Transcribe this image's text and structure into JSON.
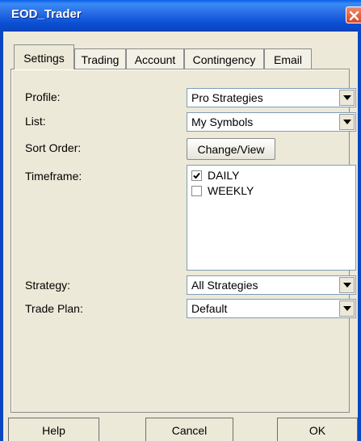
{
  "window": {
    "title": "EOD_Trader"
  },
  "tabs": [
    {
      "label": "Settings"
    },
    {
      "label": "Trading"
    },
    {
      "label": "Account"
    },
    {
      "label": "Contingency"
    },
    {
      "label": "Email"
    }
  ],
  "settings": {
    "profile_label": "Profile:",
    "profile_value": "Pro Strategies",
    "list_label": "List:",
    "list_value": "My Symbols",
    "sort_label": "Sort Order:",
    "sort_button": "Change/View",
    "timeframe_label": "Timeframe:",
    "timeframes": [
      {
        "label": "DAILY",
        "checked": true
      },
      {
        "label": "WEEKLY",
        "checked": false
      }
    ],
    "strategy_label": "Strategy:",
    "strategy_value": "All Strategies",
    "tradeplan_label": "Trade Plan:",
    "tradeplan_value": "Default"
  },
  "buttons": {
    "help": "Help",
    "cancel": "Cancel",
    "ok": "OK"
  },
  "colors": {
    "titlebar": "#0A46C2",
    "dialog_bg": "#ECE9D8",
    "field_border": "#7F9DB9"
  }
}
